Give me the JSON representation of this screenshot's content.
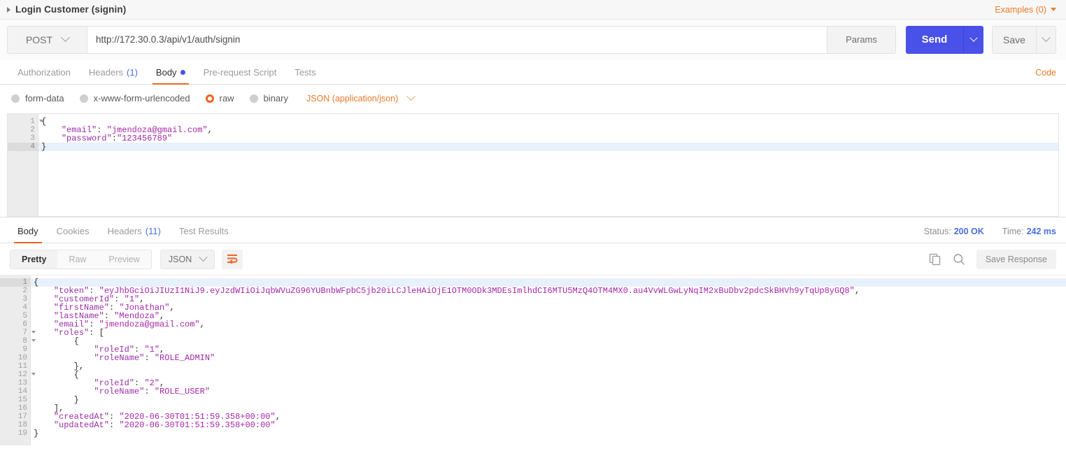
{
  "request": {
    "title": "Login Customer (signin)",
    "examples_label": "Examples (0)",
    "method": "POST",
    "url": "http://172.30.0.3/api/v1/auth/signin",
    "params_label": "Params",
    "send_label": "Send",
    "save_label": "Save",
    "code_label": "Code",
    "tabs": [
      {
        "label": "Authorization",
        "count": "",
        "active": false
      },
      {
        "label": "Headers",
        "count": "(1)",
        "active": false
      },
      {
        "label": "Body",
        "count": "",
        "active": true
      },
      {
        "label": "Pre-request Script",
        "count": "",
        "active": false
      },
      {
        "label": "Tests",
        "count": "",
        "active": false
      }
    ],
    "body_types": [
      {
        "label": "form-data",
        "selected": false
      },
      {
        "label": "x-www-form-urlencoded",
        "selected": false
      },
      {
        "label": "raw",
        "selected": true
      },
      {
        "label": "binary",
        "selected": false
      }
    ],
    "raw_format": "JSON (application/json)",
    "body_lines": [
      {
        "n": "1",
        "fold": true,
        "sel": false,
        "text": "{"
      },
      {
        "n": "2",
        "fold": false,
        "sel": false,
        "text": "    \"email\": \"jmendoza@gmail.com\","
      },
      {
        "n": "3",
        "fold": false,
        "sel": false,
        "text": "    \"password\":\"123456789\""
      },
      {
        "n": "4",
        "fold": false,
        "sel": true,
        "text": "}"
      }
    ]
  },
  "response": {
    "tabs": [
      {
        "label": "Body",
        "count": "",
        "active": true
      },
      {
        "label": "Cookies",
        "count": "",
        "active": false
      },
      {
        "label": "Headers",
        "count": "(11)",
        "active": false
      },
      {
        "label": "Test Results",
        "count": "",
        "active": false
      }
    ],
    "status_label": "Status:",
    "status_value": "200 OK",
    "time_label": "Time:",
    "time_value": "242 ms",
    "view_modes": [
      {
        "label": "Pretty",
        "active": true
      },
      {
        "label": "Raw",
        "active": false
      },
      {
        "label": "Preview",
        "active": false
      }
    ],
    "format": "JSON",
    "save_response_label": "Save Response",
    "body_lines": [
      {
        "n": "1",
        "fold": true,
        "sel": true,
        "text": "{"
      },
      {
        "n": "2",
        "fold": false,
        "sel": false,
        "text": "    \"token\": \"eyJhbGciOiJIUzI1NiJ9.eyJzdWIiOiJqbWVuZG96YUBnbWFpbC5jb20iLCJleHAiOjE1OTM0ODk3MDEsImlhdCI6MTU5MzQ4OTM4MX0.au4VvWLGwLyNqIM2xBuDbv2pdcSkBHVh9yTqUp8yGQ8\","
      },
      {
        "n": "3",
        "fold": false,
        "sel": false,
        "text": "    \"customerId\": \"1\","
      },
      {
        "n": "4",
        "fold": false,
        "sel": false,
        "text": "    \"firstName\": \"Jonathan\","
      },
      {
        "n": "5",
        "fold": false,
        "sel": false,
        "text": "    \"lastName\": \"Mendoza\","
      },
      {
        "n": "6",
        "fold": false,
        "sel": false,
        "text": "    \"email\": \"jmendoza@gmail.com\","
      },
      {
        "n": "7",
        "fold": true,
        "sel": false,
        "text": "    \"roles\": ["
      },
      {
        "n": "8",
        "fold": true,
        "sel": false,
        "text": "        {"
      },
      {
        "n": "9",
        "fold": false,
        "sel": false,
        "text": "            \"roleId\": \"1\","
      },
      {
        "n": "10",
        "fold": false,
        "sel": false,
        "text": "            \"roleName\": \"ROLE_ADMIN\""
      },
      {
        "n": "11",
        "fold": false,
        "sel": false,
        "text": "        },"
      },
      {
        "n": "12",
        "fold": true,
        "sel": false,
        "text": "        {"
      },
      {
        "n": "13",
        "fold": false,
        "sel": false,
        "text": "            \"roleId\": \"2\","
      },
      {
        "n": "14",
        "fold": false,
        "sel": false,
        "text": "            \"roleName\": \"ROLE_USER\""
      },
      {
        "n": "15",
        "fold": false,
        "sel": false,
        "text": "        }"
      },
      {
        "n": "16",
        "fold": false,
        "sel": false,
        "text": "    ],"
      },
      {
        "n": "17",
        "fold": false,
        "sel": false,
        "text": "    \"createdAt\": \"2020-06-30T01:51:59.358+00:00\","
      },
      {
        "n": "18",
        "fold": false,
        "sel": false,
        "text": "    \"updatedAt\": \"2020-06-30T01:51:59.358+00:00\""
      },
      {
        "n": "19",
        "fold": false,
        "sel": false,
        "text": "}"
      }
    ]
  },
  "colors": {
    "accent_orange": "#f06422",
    "link_orange": "#ec7a28",
    "send_blue": "#4a51e8",
    "status_blue": "#4a6fe0",
    "json_string": "#a626a6"
  },
  "icons": {
    "collapse": "caret-right-icon",
    "examples_caret": "chevron-down-icon",
    "method_caret": "chevron-down-icon",
    "send_caret": "chevron-down-icon",
    "save_caret": "chevron-down-icon",
    "format_caret": "chevron-down-icon",
    "wrap": "wrap-lines-icon",
    "copy": "copy-icon",
    "search": "search-icon"
  }
}
